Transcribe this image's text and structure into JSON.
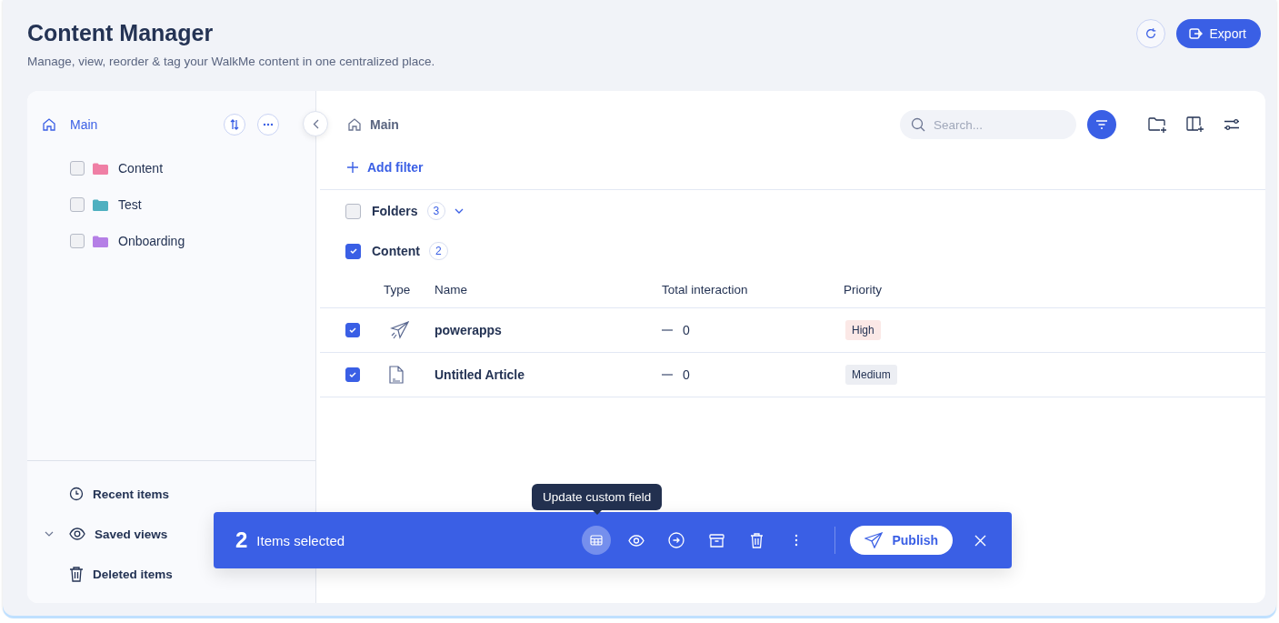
{
  "header": {
    "title": "Content Manager",
    "subtitle": "Manage, view, reorder & tag your WalkMe content in one centralized place.",
    "export_label": "Export"
  },
  "sidebar": {
    "root": "Main",
    "folders": [
      {
        "name": "Content",
        "color": "#ef7fa5",
        "checked": false
      },
      {
        "name": "Test",
        "color": "#4fb0c0",
        "checked": false
      },
      {
        "name": "Onboarding",
        "color": "#b57fe6",
        "checked": false
      }
    ],
    "bottom_items": [
      {
        "label": "Recent items",
        "kind": "recent"
      },
      {
        "label": "Saved views",
        "kind": "saved"
      },
      {
        "label": "Deleted items",
        "kind": "deleted"
      }
    ]
  },
  "main": {
    "breadcrumb": "Main",
    "search": {
      "placeholder": "Search..."
    },
    "add_filter": "Add filter",
    "groups": [
      {
        "label": "Folders",
        "count": "3",
        "checked": false,
        "expandable": true
      },
      {
        "label": "Content",
        "count": "2",
        "checked": true,
        "expandable": false
      }
    ],
    "table": {
      "columns": [
        "Type",
        "Name",
        "Total interaction",
        "Priority"
      ],
      "rows": [
        {
          "kind": "launch",
          "checked": true,
          "name": "powerapps",
          "interaction": "0",
          "priority": "High",
          "color": "#fbe8e6"
        },
        {
          "kind": "article",
          "checked": true,
          "name": "Untitled Article",
          "interaction": "0",
          "priority": "Medium",
          "color": "#eceef3"
        }
      ]
    }
  },
  "selection_bar": {
    "count": "2",
    "label": "Items selected",
    "tooltip": "Update custom field",
    "actions": [
      {
        "kind": "custom-field",
        "selected": true
      },
      {
        "kind": "preview",
        "selected": false
      },
      {
        "kind": "move",
        "selected": false
      },
      {
        "kind": "archive",
        "selected": false
      },
      {
        "kind": "delete",
        "selected": false
      },
      {
        "kind": "more",
        "selected": false
      }
    ],
    "publish_label": "Publish"
  }
}
